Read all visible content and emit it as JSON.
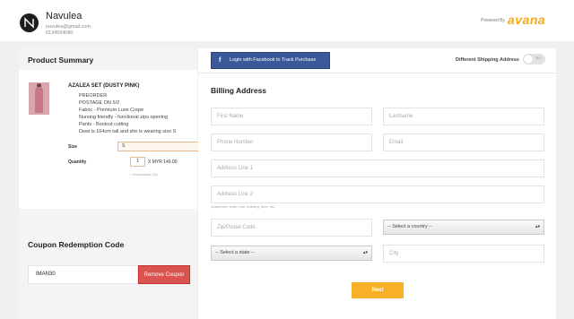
{
  "header": {
    "logo_icon": "n-monogram-icon",
    "store_name": "Navulea",
    "email": "navulea@gmail.com",
    "phone": "0134594080",
    "powered_by": "Powered By",
    "brand": "avana",
    "brand_color": "#f7a81b"
  },
  "summary": {
    "title": "Product Summary",
    "product": {
      "name": "AZALEA SET (DUSTY PINK)",
      "description": [
        "PREORDER",
        "POSTAGE ON 5/2",
        "Fabric - Premium Luxe Crepe",
        "Nursing friendly - functional zips opening",
        "Pants - Bootcut cutting",
        "Dewi is 164cm tall and she is wearing size S"
      ],
      "size_label": "Size",
      "size_value": "S",
      "quantity_label": "Quantity",
      "quantity_value": "1",
      "price_text": "X  MYR 149.00",
      "stock_note": "* Unavailable Qty"
    }
  },
  "coupon": {
    "title": "Coupon Redemption Code",
    "code": "IMAN30",
    "remove_label": "Remove Coupon",
    "remove_color": "#d9534f"
  },
  "billing": {
    "fb_icon": "facebook-icon",
    "fb_label": "Login with Facebook to Track Purchase",
    "fb_color": "#3b5998",
    "diff_shipping_label": "Different Shipping Address",
    "toggle_text": "No",
    "title": "Billing Address",
    "first_name": "First Name",
    "last_name": "Lastname",
    "phone": "Phone Number",
    "email": "Email",
    "address1": "Address Line 1",
    "address2": "Address Line 2",
    "address_hint": "Apartment, suite, unit, building, floor, etc",
    "zip": "Zip/Postal Code",
    "country": "-- Select a country --",
    "state": "-- Select a state --",
    "city": "City",
    "next_label": "Next",
    "next_color": "#f7b028"
  }
}
